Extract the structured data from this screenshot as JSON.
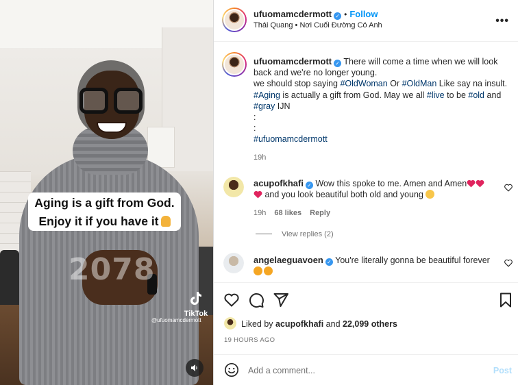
{
  "media": {
    "caption_line1": "Aging is a gift from God.",
    "caption_line2": "Enjoy it if you have it",
    "overlay_number": "2078",
    "watermark": "TikTok",
    "watermark_user": "@ufuomamcdermott"
  },
  "post": {
    "author": "ufuomamcdermott",
    "follow_label": "Follow",
    "location": "Thái Quang • Nơi Cuối Đường Có Anh",
    "caption": {
      "author": "ufuomamcdermott",
      "text1": "There will come a time when we will look back and we're no longer young.",
      "text2a": "we should stop saying ",
      "tag_oldwoman": "#OldWoman",
      "text2b": " Or ",
      "tag_oldman": "#OldMan",
      "text2c": " Like say na insult.",
      "tag_aging": "#Aging",
      "text3a": " is actually a gift from God. May we all ",
      "tag_live": "#live",
      "text3b": " to be ",
      "tag_old": "#old",
      "text3c": " and",
      "tag_gray": "#gray",
      "text4": " IJN",
      "colon1": ":",
      "colon2": ":",
      "tag_user": "#ufuomamcdermott",
      "time": "19h"
    },
    "comments": [
      {
        "user": "acupofkhafi",
        "text_a": "Wow this spoke to me. Amen and Amen",
        "text_b": " and you look beautiful both old and young ",
        "time": "19h",
        "likes": "68 likes",
        "reply": "Reply",
        "view_replies": "View replies (2)"
      },
      {
        "user": "angelaeguavoen",
        "text_a": "You're literally gonna be beautiful forever"
      }
    ],
    "liked_by_prefix": "Liked by ",
    "liked_by_user": "acupofkhafi",
    "liked_by_and": " and ",
    "liked_by_count": "22,099 others",
    "posted_ago": "19 HOURS AGO",
    "add_comment_placeholder": "Add a comment...",
    "post_label": "Post"
  },
  "colors": {
    "link_blue": "#0095f6",
    "hashtag": "#00376b",
    "verified": "#3797f0",
    "muted": "#737373",
    "heart_red": "#ed4956"
  },
  "icons": [
    "more-icon",
    "verified-icon",
    "heart-icon",
    "comment-icon",
    "share-icon",
    "bookmark-icon",
    "emoji-icon",
    "sound-icon",
    "tiktok-icon"
  ]
}
